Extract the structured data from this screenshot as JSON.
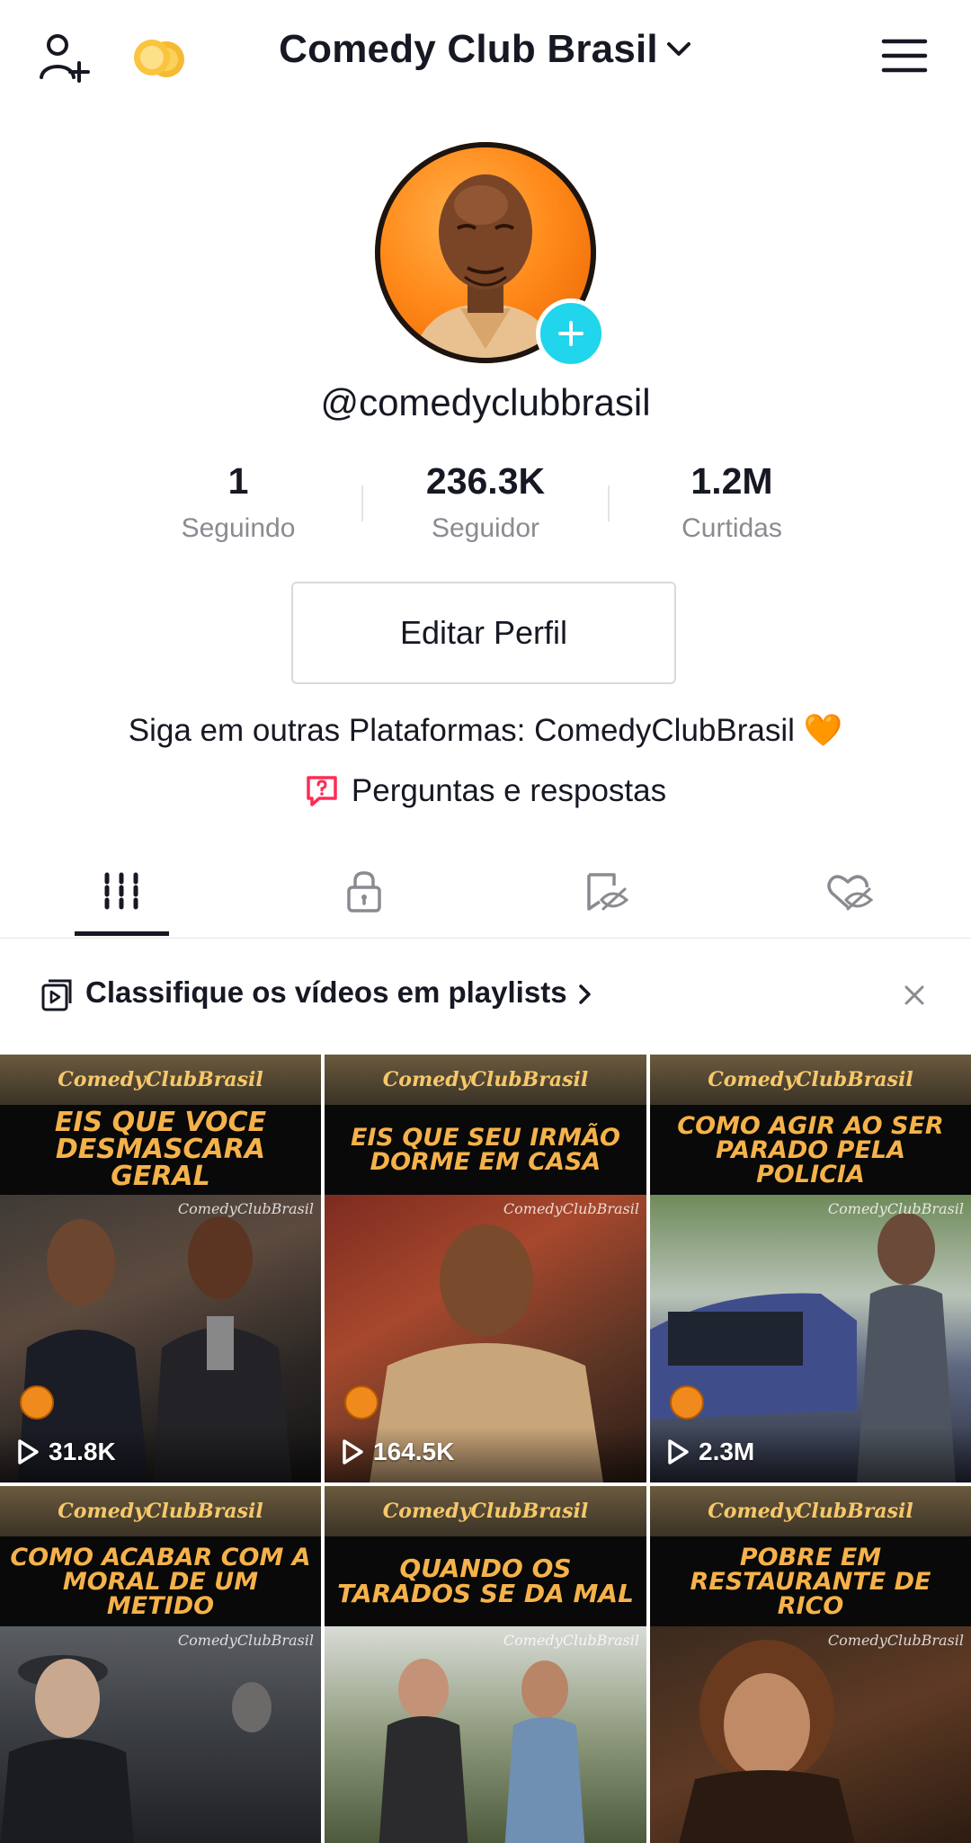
{
  "header": {
    "title": "Comedy Club Brasil",
    "icons": {
      "add_user": "add-user-icon",
      "coins": "coins-icon",
      "chevron": "chevron-down-icon",
      "menu": "menu-icon"
    }
  },
  "profile": {
    "username": "@comedyclubbrasil",
    "stats": [
      {
        "value": "1",
        "label": "Seguindo"
      },
      {
        "value": "236.3K",
        "label": "Seguidor"
      },
      {
        "value": "1.2M",
        "label": "Curtidas"
      }
    ],
    "edit_button": "Editar Perfil",
    "bio": "Siga em outras Plataformas: ComedyClubBrasil 🧡",
    "qa_label": "Perguntas e respostas"
  },
  "tabs": [
    {
      "name": "videos",
      "icon": "grid-icon"
    },
    {
      "name": "private",
      "icon": "lock-icon"
    },
    {
      "name": "reposts-hidden",
      "icon": "bookmark-eye-off-icon"
    },
    {
      "name": "liked-hidden",
      "icon": "heart-eye-off-icon"
    }
  ],
  "banner": {
    "text": "Classifique os vídeos em playlists"
  },
  "brand_text": "ComedyClubBrasil",
  "videos": [
    {
      "headline": "EIS QUE VOCE DESMASCARA GERAL",
      "views": "31.8K"
    },
    {
      "headline": "EIS QUE SEU IRMÃO DORME EM CASA",
      "views": "164.5K"
    },
    {
      "headline": "COMO AGIR AO SER PARADO PELA POLICIA",
      "views": "2.3M"
    },
    {
      "headline": "COMO ACABAR COM A MORAL DE UM METIDO",
      "views": ""
    },
    {
      "headline": "QUANDO OS TARADOS SE DA MAL",
      "views": ""
    },
    {
      "headline": "POBRE EM RESTAURANTE DE RICO",
      "views": ""
    }
  ],
  "colors": {
    "accent_cyan": "#20d5ec",
    "qa_red": "#fe2c55",
    "text": "#161823",
    "muted": "#8a8b91"
  }
}
